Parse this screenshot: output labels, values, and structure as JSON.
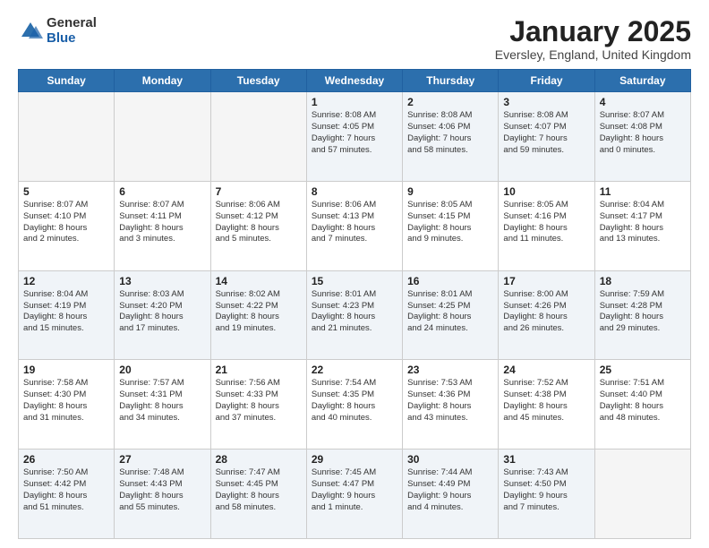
{
  "logo": {
    "general": "General",
    "blue": "Blue"
  },
  "title": "January 2025",
  "location": "Eversley, England, United Kingdom",
  "days_header": [
    "Sunday",
    "Monday",
    "Tuesday",
    "Wednesday",
    "Thursday",
    "Friday",
    "Saturday"
  ],
  "weeks": [
    [
      {
        "day": "",
        "info": ""
      },
      {
        "day": "",
        "info": ""
      },
      {
        "day": "",
        "info": ""
      },
      {
        "day": "1",
        "info": "Sunrise: 8:08 AM\nSunset: 4:05 PM\nDaylight: 7 hours\nand 57 minutes."
      },
      {
        "day": "2",
        "info": "Sunrise: 8:08 AM\nSunset: 4:06 PM\nDaylight: 7 hours\nand 58 minutes."
      },
      {
        "day": "3",
        "info": "Sunrise: 8:08 AM\nSunset: 4:07 PM\nDaylight: 7 hours\nand 59 minutes."
      },
      {
        "day": "4",
        "info": "Sunrise: 8:07 AM\nSunset: 4:08 PM\nDaylight: 8 hours\nand 0 minutes."
      }
    ],
    [
      {
        "day": "5",
        "info": "Sunrise: 8:07 AM\nSunset: 4:10 PM\nDaylight: 8 hours\nand 2 minutes."
      },
      {
        "day": "6",
        "info": "Sunrise: 8:07 AM\nSunset: 4:11 PM\nDaylight: 8 hours\nand 3 minutes."
      },
      {
        "day": "7",
        "info": "Sunrise: 8:06 AM\nSunset: 4:12 PM\nDaylight: 8 hours\nand 5 minutes."
      },
      {
        "day": "8",
        "info": "Sunrise: 8:06 AM\nSunset: 4:13 PM\nDaylight: 8 hours\nand 7 minutes."
      },
      {
        "day": "9",
        "info": "Sunrise: 8:05 AM\nSunset: 4:15 PM\nDaylight: 8 hours\nand 9 minutes."
      },
      {
        "day": "10",
        "info": "Sunrise: 8:05 AM\nSunset: 4:16 PM\nDaylight: 8 hours\nand 11 minutes."
      },
      {
        "day": "11",
        "info": "Sunrise: 8:04 AM\nSunset: 4:17 PM\nDaylight: 8 hours\nand 13 minutes."
      }
    ],
    [
      {
        "day": "12",
        "info": "Sunrise: 8:04 AM\nSunset: 4:19 PM\nDaylight: 8 hours\nand 15 minutes."
      },
      {
        "day": "13",
        "info": "Sunrise: 8:03 AM\nSunset: 4:20 PM\nDaylight: 8 hours\nand 17 minutes."
      },
      {
        "day": "14",
        "info": "Sunrise: 8:02 AM\nSunset: 4:22 PM\nDaylight: 8 hours\nand 19 minutes."
      },
      {
        "day": "15",
        "info": "Sunrise: 8:01 AM\nSunset: 4:23 PM\nDaylight: 8 hours\nand 21 minutes."
      },
      {
        "day": "16",
        "info": "Sunrise: 8:01 AM\nSunset: 4:25 PM\nDaylight: 8 hours\nand 24 minutes."
      },
      {
        "day": "17",
        "info": "Sunrise: 8:00 AM\nSunset: 4:26 PM\nDaylight: 8 hours\nand 26 minutes."
      },
      {
        "day": "18",
        "info": "Sunrise: 7:59 AM\nSunset: 4:28 PM\nDaylight: 8 hours\nand 29 minutes."
      }
    ],
    [
      {
        "day": "19",
        "info": "Sunrise: 7:58 AM\nSunset: 4:30 PM\nDaylight: 8 hours\nand 31 minutes."
      },
      {
        "day": "20",
        "info": "Sunrise: 7:57 AM\nSunset: 4:31 PM\nDaylight: 8 hours\nand 34 minutes."
      },
      {
        "day": "21",
        "info": "Sunrise: 7:56 AM\nSunset: 4:33 PM\nDaylight: 8 hours\nand 37 minutes."
      },
      {
        "day": "22",
        "info": "Sunrise: 7:54 AM\nSunset: 4:35 PM\nDaylight: 8 hours\nand 40 minutes."
      },
      {
        "day": "23",
        "info": "Sunrise: 7:53 AM\nSunset: 4:36 PM\nDaylight: 8 hours\nand 43 minutes."
      },
      {
        "day": "24",
        "info": "Sunrise: 7:52 AM\nSunset: 4:38 PM\nDaylight: 8 hours\nand 45 minutes."
      },
      {
        "day": "25",
        "info": "Sunrise: 7:51 AM\nSunset: 4:40 PM\nDaylight: 8 hours\nand 48 minutes."
      }
    ],
    [
      {
        "day": "26",
        "info": "Sunrise: 7:50 AM\nSunset: 4:42 PM\nDaylight: 8 hours\nand 51 minutes."
      },
      {
        "day": "27",
        "info": "Sunrise: 7:48 AM\nSunset: 4:43 PM\nDaylight: 8 hours\nand 55 minutes."
      },
      {
        "day": "28",
        "info": "Sunrise: 7:47 AM\nSunset: 4:45 PM\nDaylight: 8 hours\nand 58 minutes."
      },
      {
        "day": "29",
        "info": "Sunrise: 7:45 AM\nSunset: 4:47 PM\nDaylight: 9 hours\nand 1 minute."
      },
      {
        "day": "30",
        "info": "Sunrise: 7:44 AM\nSunset: 4:49 PM\nDaylight: 9 hours\nand 4 minutes."
      },
      {
        "day": "31",
        "info": "Sunrise: 7:43 AM\nSunset: 4:50 PM\nDaylight: 9 hours\nand 7 minutes."
      },
      {
        "day": "",
        "info": ""
      }
    ]
  ]
}
